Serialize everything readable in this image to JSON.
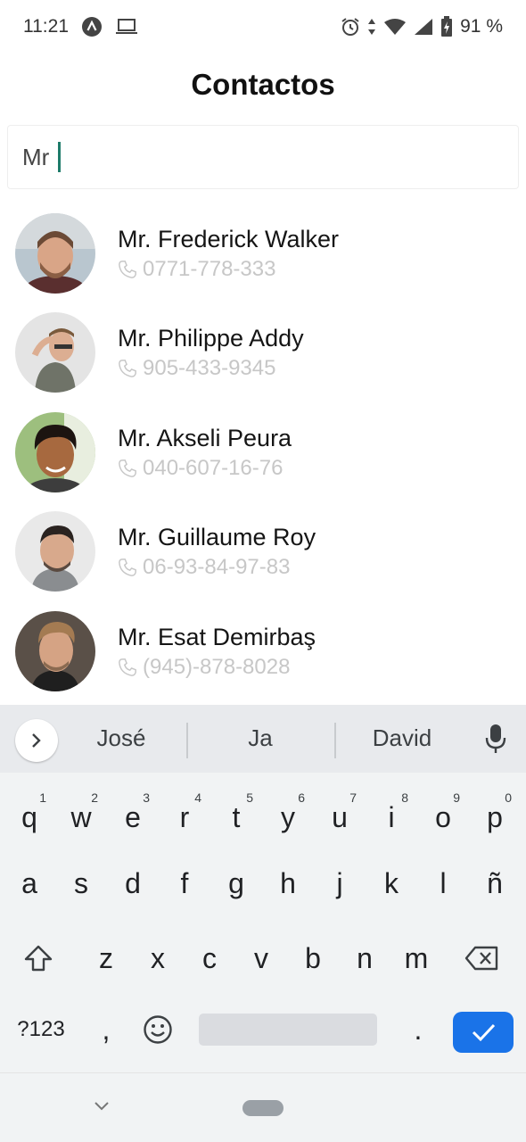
{
  "status_bar": {
    "time": "11:21",
    "battery": "91 %",
    "icons": [
      "notification-a-icon",
      "laptop-icon",
      "alarm-icon",
      "data-arrows-icon",
      "wifi-icon",
      "signal-icon",
      "battery-charging-icon"
    ]
  },
  "title": "Contactos",
  "search": {
    "value": "Mr"
  },
  "contacts": [
    {
      "name": "Mr. Frederick Walker",
      "phone": "0771-778-333"
    },
    {
      "name": "Mr. Philippe Addy",
      "phone": "905-433-9345"
    },
    {
      "name": "Mr. Akseli Peura",
      "phone": "040-607-16-76"
    },
    {
      "name": "Mr. Guillaume Roy",
      "phone": "06-93-84-97-83"
    },
    {
      "name": "Mr. Esat Demirbaş",
      "phone": "(945)-878-8028"
    }
  ],
  "keyboard": {
    "suggestions": [
      "José",
      "Ja",
      "David"
    ],
    "row1": [
      {
        "k": "q",
        "n": "1"
      },
      {
        "k": "w",
        "n": "2"
      },
      {
        "k": "e",
        "n": "3"
      },
      {
        "k": "r",
        "n": "4"
      },
      {
        "k": "t",
        "n": "5"
      },
      {
        "k": "y",
        "n": "6"
      },
      {
        "k": "u",
        "n": "7"
      },
      {
        "k": "i",
        "n": "8"
      },
      {
        "k": "o",
        "n": "9"
      },
      {
        "k": "p",
        "n": "0"
      }
    ],
    "row2": [
      "a",
      "s",
      "d",
      "f",
      "g",
      "h",
      "j",
      "k",
      "l",
      "ñ"
    ],
    "row3": [
      "z",
      "x",
      "c",
      "v",
      "b",
      "n",
      "m"
    ],
    "symbols_label": "?123",
    "comma": ",",
    "period": "."
  },
  "colors": {
    "accent": "#1a73e8",
    "caret": "#1e7b6a",
    "phone_text": "#c7c7c7"
  }
}
